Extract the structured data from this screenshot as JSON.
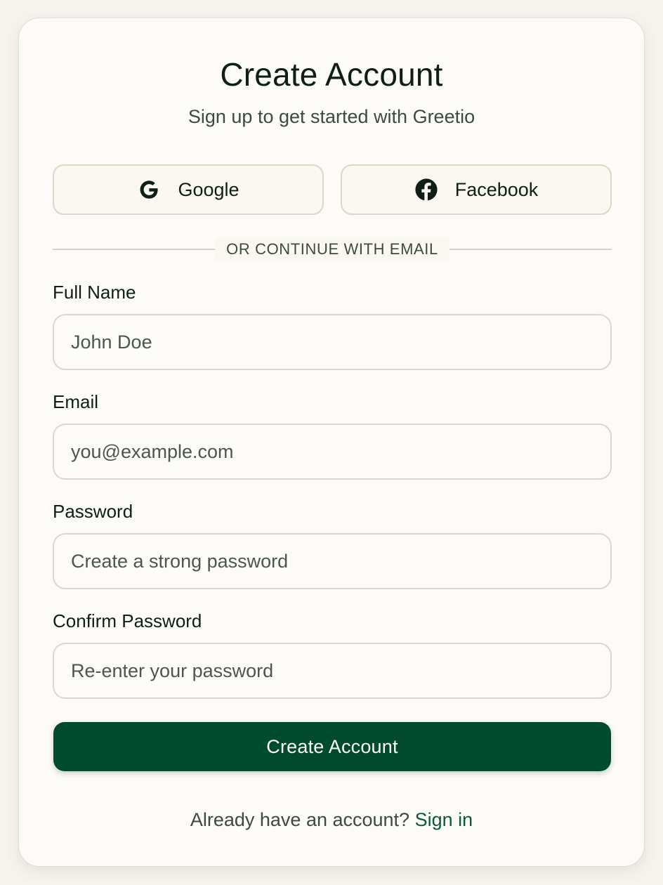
{
  "header": {
    "title": "Create Account",
    "subtitle": "Sign up to get started with Greetio"
  },
  "social": {
    "google_label": "Google",
    "google_icon": "google-g-icon",
    "facebook_label": "Facebook",
    "facebook_icon": "facebook-icon"
  },
  "divider": {
    "text": "OR CONTINUE WITH EMAIL"
  },
  "form": {
    "full_name": {
      "label": "Full Name",
      "placeholder": "John Doe",
      "value": ""
    },
    "email": {
      "label": "Email",
      "placeholder": "you@example.com",
      "value": ""
    },
    "password": {
      "label": "Password",
      "placeholder": "Create a strong password",
      "value": ""
    },
    "confirm_password": {
      "label": "Confirm Password",
      "placeholder": "Re-enter your password",
      "value": ""
    },
    "submit_label": "Create Account"
  },
  "footer": {
    "prompt": "Already have an account?",
    "link_label": "Sign in"
  },
  "colors": {
    "accent": "#004b2e",
    "link": "#0b5a3a",
    "page_background": "#f7f4ef",
    "card_background": "#fdfbf7",
    "text_primary": "#0e1f17",
    "text_secondary": "#3d4a43",
    "border": "#ddd6ca"
  }
}
